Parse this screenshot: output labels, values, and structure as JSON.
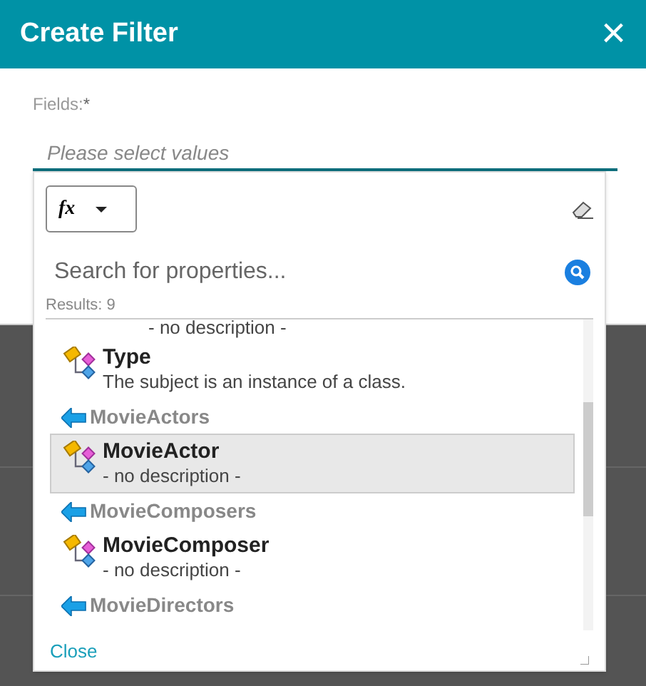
{
  "dialog": {
    "title": "Create Filter",
    "close_label": "×"
  },
  "fields": {
    "label": "Fields:",
    "required_mark": "*",
    "placeholder": "Please select values"
  },
  "popup": {
    "function_button": {
      "label": "fx"
    },
    "search": {
      "placeholder": "Search for properties..."
    },
    "results": "Results: 9",
    "items": [
      {
        "kind": "fragment",
        "description": "- no description -"
      },
      {
        "kind": "property",
        "name": "Type",
        "description": "The subject is an instance of a class.",
        "selected": false
      },
      {
        "kind": "group",
        "name": "MovieActors"
      },
      {
        "kind": "property",
        "name": "MovieActor",
        "description": "- no description -",
        "selected": true
      },
      {
        "kind": "group",
        "name": "MovieComposers"
      },
      {
        "kind": "property",
        "name": "MovieComposer",
        "description": "- no description -",
        "selected": false
      },
      {
        "kind": "group",
        "name": "MovieDirectors"
      }
    ],
    "close_link": "Close"
  }
}
